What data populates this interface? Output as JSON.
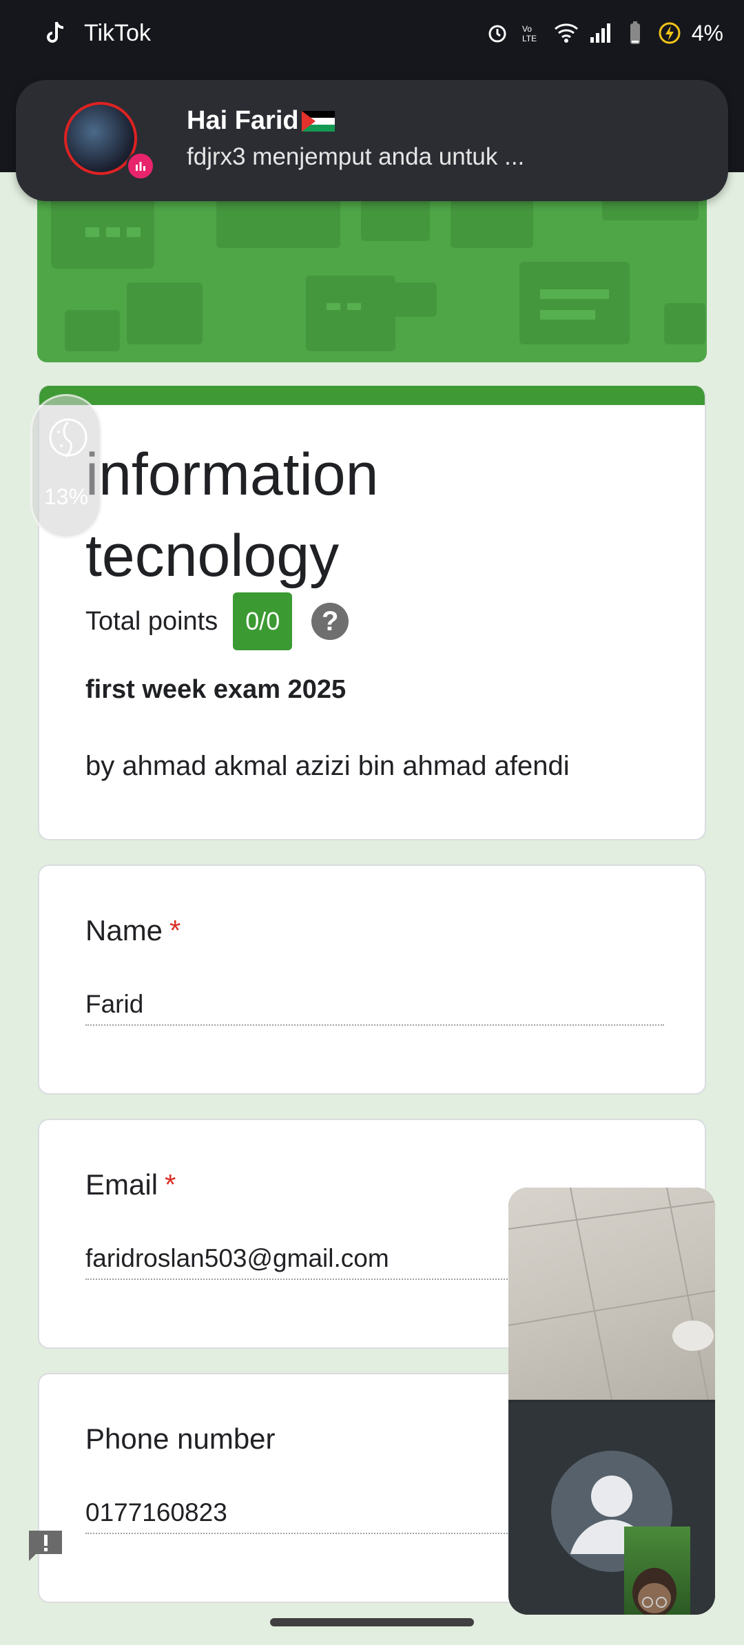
{
  "status_bar": {
    "app_name": "TikTok",
    "battery": "4%"
  },
  "notification": {
    "title": "Hai Farid",
    "message": "fdjrx3 menjemput anda untuk ..."
  },
  "assistant": {
    "percent": "13%"
  },
  "form": {
    "title_line1": "information",
    "title_line2": "tecnology",
    "points_label": "Total points",
    "points_value": "0/0",
    "help_glyph": "?",
    "subtitle": "first week exam 2025",
    "description": "by ahmad akmal azizi bin ahmad afendi",
    "questions": [
      {
        "label": "Name",
        "required": "*",
        "value": "Farid"
      },
      {
        "label": "Email",
        "required": "*",
        "value": "faridroslan503@gmail.com"
      },
      {
        "label": "Phone number",
        "required": "",
        "value": "0177160823"
      }
    ]
  },
  "colors": {
    "accent": "#3c9a33",
    "banner": "#4ea647",
    "required": "#d93025",
    "background": "#e2eedf"
  }
}
